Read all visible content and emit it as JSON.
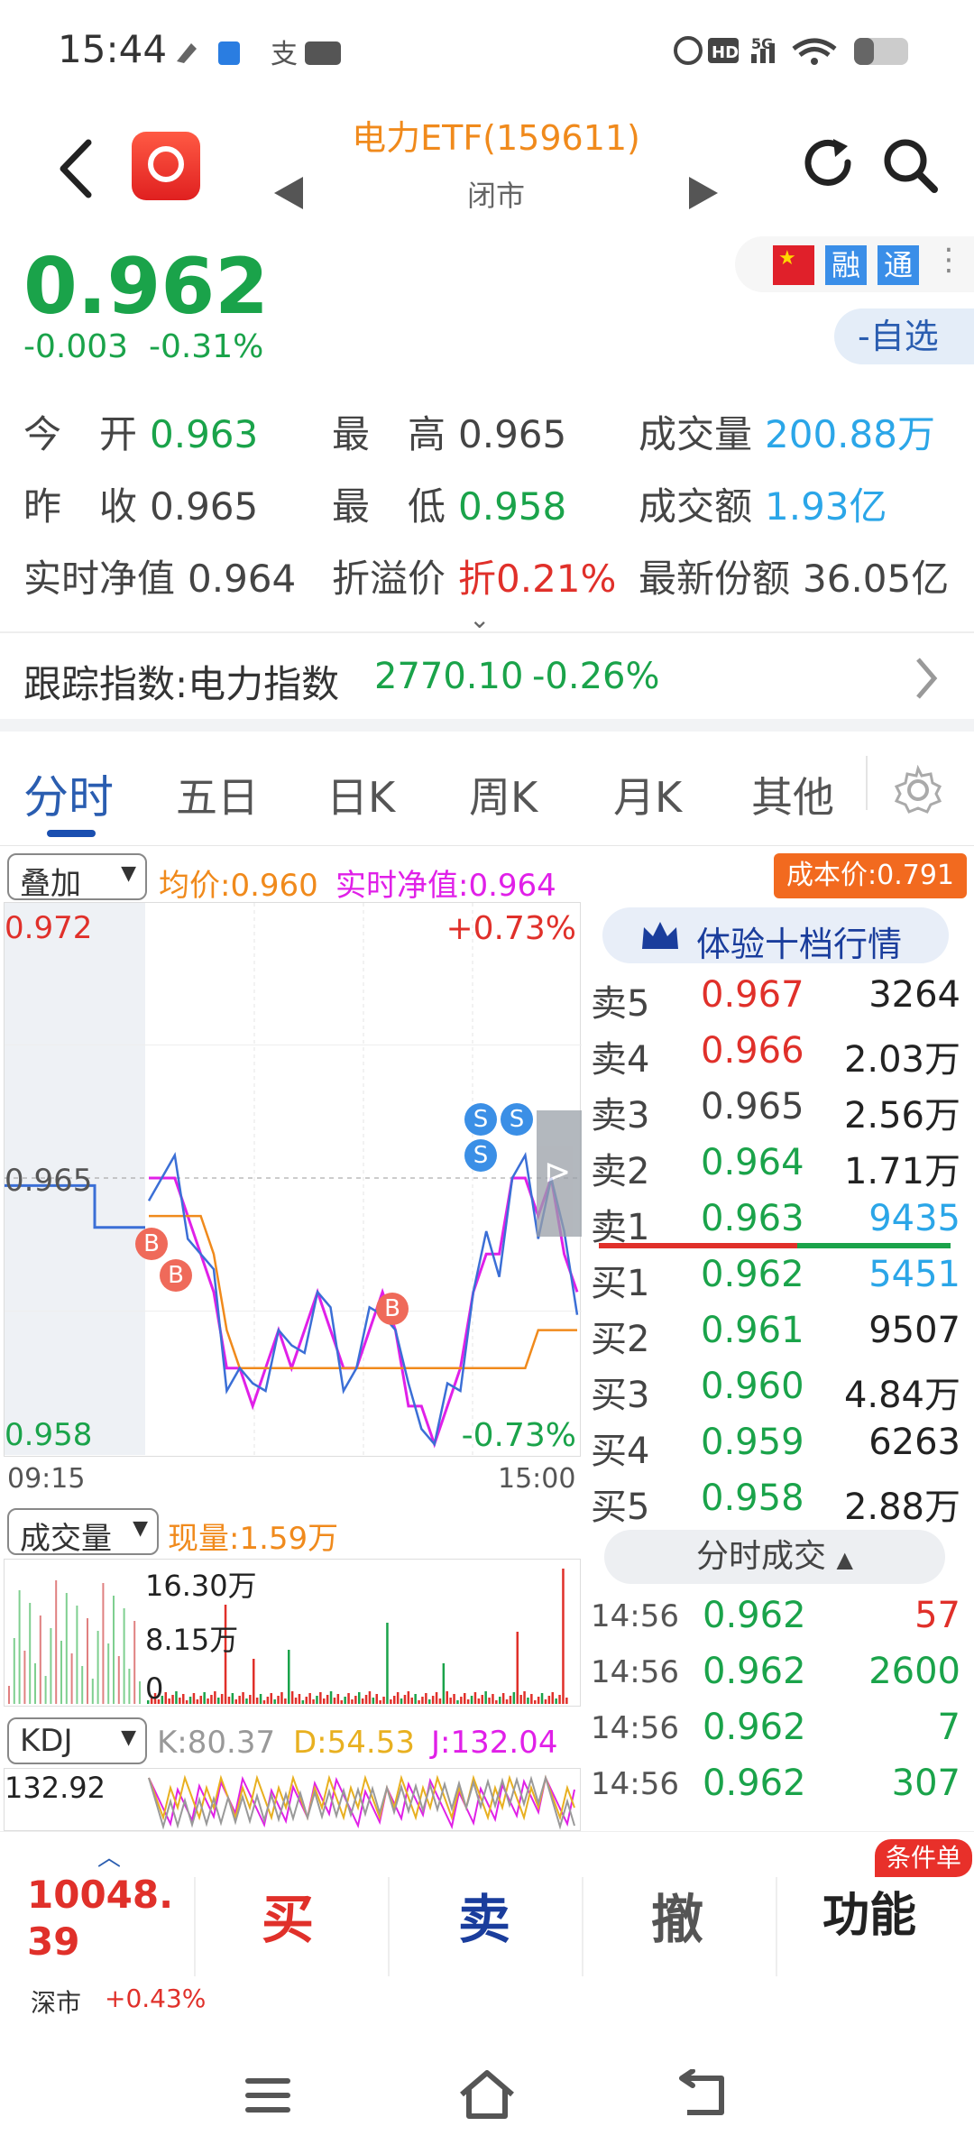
{
  "status_bar": {
    "time": "15:44"
  },
  "header": {
    "title": "电力ETF(159611)",
    "subtitle": "闭市"
  },
  "badges": {
    "rong": "融",
    "tong": "通"
  },
  "quote": {
    "price": "0.962",
    "change": "-0.003",
    "change_pct": "-0.31%",
    "watch_label": "-自选"
  },
  "stats": [
    {
      "label": "今　开",
      "value": "0.963"
    },
    {
      "label": "最　高",
      "value": "0.965"
    },
    {
      "label": "成交量",
      "value": "200.88万"
    },
    {
      "label": "昨　收",
      "value": "0.965"
    },
    {
      "label": "最　低",
      "value": "0.958"
    },
    {
      "label": "成交额",
      "value": "1.93亿"
    },
    {
      "label": "实时净值",
      "value": "0.964"
    },
    {
      "label": "折溢价",
      "value": "折0.21%"
    },
    {
      "label": "最新份额",
      "value": "36.05亿"
    }
  ],
  "index": {
    "label": "跟踪指数:电力指数",
    "value": "2770.10",
    "pct": "-0.26%"
  },
  "tabs": [
    "分时",
    "五日",
    "日K",
    "周K",
    "月K",
    "其他"
  ],
  "overlay": {
    "select": "叠加",
    "avg": "均价:0.960",
    "nav": "实时净值:0.964",
    "cost": "成本价:0.791"
  },
  "chart": {
    "y_high": "0.972",
    "y_prev": "0.965",
    "y_low": "0.958",
    "pct_high": "+0.73%",
    "pct_low": "-0.73%",
    "t_start": "09:15",
    "t_end": "15:00"
  },
  "chart_data": {
    "type": "line",
    "x_range": [
      "09:15",
      "15:00"
    ],
    "ylim": [
      0.958,
      0.972
    ],
    "prev_close": 0.965,
    "series": [
      {
        "values": [
          0.965,
          0.965,
          0.965,
          0.964,
          0.963,
          0.962,
          0.96,
          0.96,
          0.959,
          0.96,
          0.961,
          0.96,
          0.961,
          0.962,
          0.961,
          0.96,
          0.96,
          0.961,
          0.962,
          0.961,
          0.959,
          0.959,
          0.958,
          0.959,
          0.96,
          0.962,
          0.963,
          0.963,
          0.965,
          0.965,
          0.964,
          0.965,
          0.963,
          0.962
        ]
      },
      {
        "values": [
          0.964,
          0.964,
          0.964,
          0.964,
          0.964,
          0.963,
          0.961,
          0.96,
          0.96,
          0.96,
          0.96,
          0.96,
          0.96,
          0.96,
          0.96,
          0.96,
          0.96,
          0.96,
          0.96,
          0.96,
          0.96,
          0.96,
          0.96,
          0.96,
          0.96,
          0.96,
          0.96,
          0.96,
          0.96,
          0.96,
          0.961,
          0.961,
          0.961,
          0.961
        ]
      }
    ]
  },
  "orderbook": {
    "banner": "体验十档行情",
    "asks": [
      {
        "label": "卖5",
        "price": "0.967",
        "vol": "3264"
      },
      {
        "label": "卖4",
        "price": "0.966",
        "vol": "2.03万"
      },
      {
        "label": "卖3",
        "price": "0.965",
        "vol": "2.56万"
      },
      {
        "label": "卖2",
        "price": "0.964",
        "vol": "1.71万"
      },
      {
        "label": "卖1",
        "price": "0.963",
        "vol": "9435"
      }
    ],
    "bids": [
      {
        "label": "买1",
        "price": "0.962",
        "vol": "5451"
      },
      {
        "label": "买2",
        "price": "0.961",
        "vol": "9507"
      },
      {
        "label": "买3",
        "price": "0.960",
        "vol": "4.84万"
      },
      {
        "label": "买4",
        "price": "0.959",
        "vol": "6263"
      },
      {
        "label": "买5",
        "price": "0.958",
        "vol": "2.88万"
      }
    ],
    "trades_label": "分时成交",
    "trades": [
      {
        "time": "14:56",
        "price": "0.962",
        "vol": "57"
      },
      {
        "time": "14:56",
        "price": "0.962",
        "vol": "2600"
      },
      {
        "time": "14:56",
        "price": "0.962",
        "vol": "7"
      },
      {
        "time": "14:56",
        "price": "0.962",
        "vol": "307"
      }
    ]
  },
  "volume": {
    "select": "成交量",
    "current": "现量:1.59万",
    "y1": "16.30万",
    "y2": "8.15万",
    "y3": "0"
  },
  "kdj": {
    "select": "KDJ",
    "k": "K:80.37",
    "d": "D:54.53",
    "j": "J:132.04",
    "y": "132.92"
  },
  "bottom": {
    "index_value": "10048.39",
    "index_name": "深市",
    "index_pct": "+0.43%",
    "buy": "买",
    "sell": "卖",
    "cancel": "撤",
    "func": "功能",
    "cond": "条件单"
  }
}
